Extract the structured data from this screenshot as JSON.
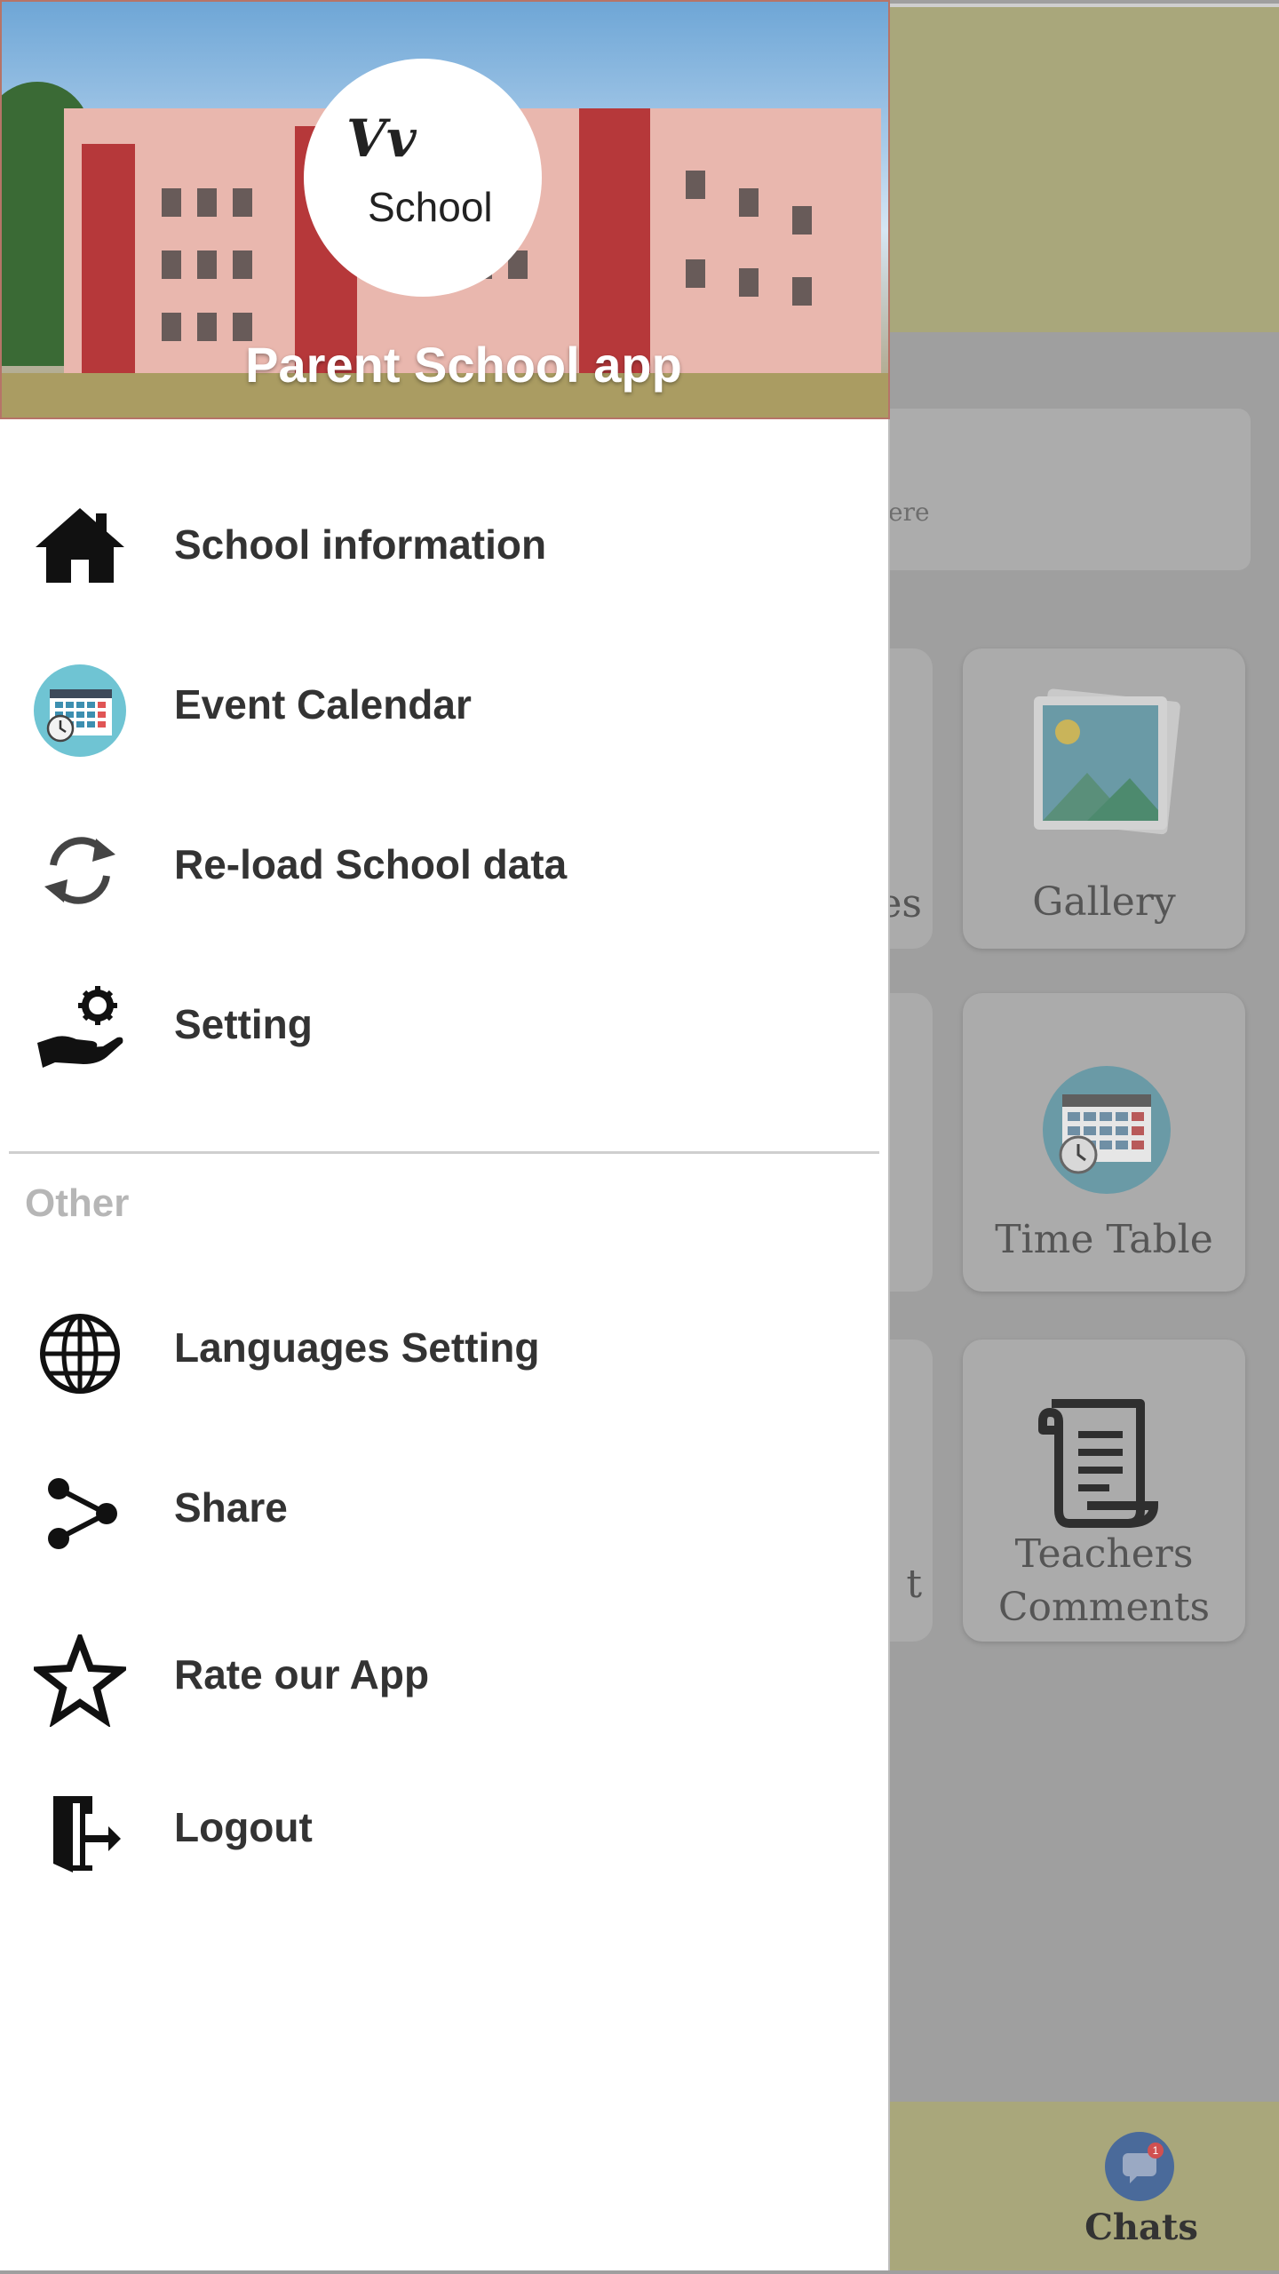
{
  "header": {
    "logo_script": "Vv",
    "logo_text": "School",
    "app_name": "Parent School app"
  },
  "menu": {
    "main_items": [
      {
        "label": "School information",
        "icon": "home-icon"
      },
      {
        "label": "Event Calendar",
        "icon": "calendar-icon"
      },
      {
        "label": "Re-load School data",
        "icon": "reload-icon"
      },
      {
        "label": "Setting",
        "icon": "settings-hand-icon"
      }
    ],
    "other_heading": "Other",
    "other_items": [
      {
        "label": "Languages Setting",
        "icon": "globe-icon"
      },
      {
        "label": "Share",
        "icon": "share-icon"
      },
      {
        "label": "Rate our App",
        "icon": "star-icon"
      },
      {
        "label": "Logout",
        "icon": "logout-icon"
      }
    ]
  },
  "background": {
    "search_fragment": "ere",
    "cards": [
      {
        "label": "Gallery",
        "icon": "gallery-icon"
      },
      {
        "label": "Time Table",
        "icon": "timetable-icon"
      },
      {
        "label": "Teachers Comments",
        "line1": "Teachers",
        "line2": "Comments",
        "icon": "scroll-icon"
      }
    ],
    "left_fragments": [
      "es",
      "t"
    ],
    "bottom_tab": {
      "label": "Chats",
      "icon": "chat-icon",
      "badge": "1"
    }
  },
  "colors": {
    "topbar": "#a9a77b",
    "overlay": "#9f9f9f",
    "menu_text": "#333333",
    "heading_gray": "#b6b6b6"
  }
}
